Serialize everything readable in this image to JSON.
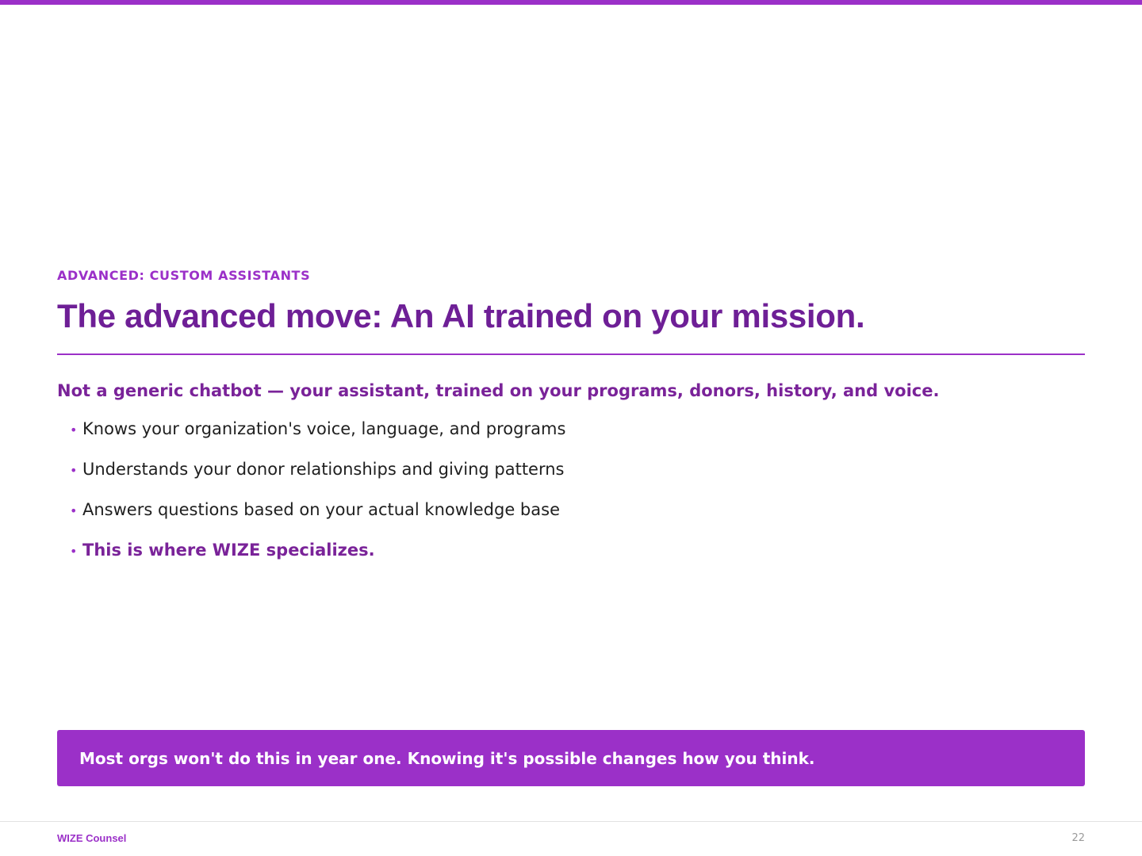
{
  "colors": {
    "accent": "#9b30c8",
    "title": "#6e1f96",
    "emphasis": "#7a2399",
    "body_text": "#1f1f1f",
    "callout_text": "#ffffff",
    "page_number": "#9a9a9a"
  },
  "slide": {
    "eyebrow": "ADVANCED: CUSTOM ASSISTANTS",
    "title": "The advanced move: An AI trained on your mission.",
    "subtitle": "Not a generic chatbot — your assistant, trained on your programs, donors, history, and voice.",
    "bullet_glyph": "•",
    "bullets": [
      "Knows your organization's voice, language, and programs",
      "Understands your donor relationships and giving patterns",
      "Answers questions based on your actual knowledge base",
      "This is where WIZE specializes."
    ],
    "callout": "Most orgs won't do this in year one. Knowing it's possible changes how you think."
  },
  "footer": {
    "brand": "WIZE Counsel",
    "page_number": "22"
  }
}
